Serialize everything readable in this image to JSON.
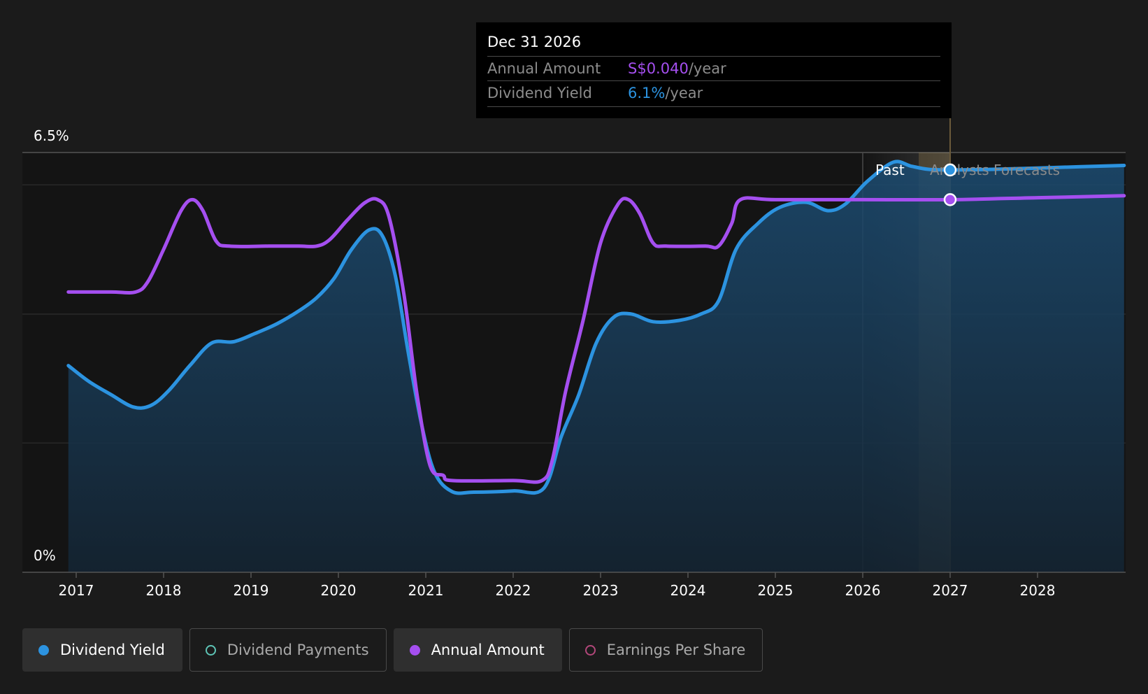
{
  "colors": {
    "background": "#1b1b1b",
    "yield": "#2c93e0",
    "annual": "#a54ff0",
    "payments": "#5ec4b6",
    "eps": "#b2477a",
    "forecast_band": "#c9a25a"
  },
  "tooltip": {
    "date": "Dec 31 2026",
    "rows": [
      {
        "label": "Annual Amount",
        "value": "S$0.040",
        "unit": "/year",
        "color": "#a54ff0"
      },
      {
        "label": "Dividend Yield",
        "value": "6.1%",
        "unit": "/year",
        "color": "#2c93e0"
      }
    ]
  },
  "chart_data": {
    "type": "line",
    "title": "",
    "xlabel": "",
    "ylabel": "",
    "x_ticks": [
      "2017",
      "2018",
      "2019",
      "2020",
      "2021",
      "2022",
      "2023",
      "2024",
      "2025",
      "2026",
      "2027",
      "2028"
    ],
    "x_range": [
      2016.4,
      2028.99
    ],
    "ylim": [
      0,
      6.5
    ],
    "y_tick_labels": [
      {
        "value": 6.5,
        "label": "6.5%"
      },
      {
        "value": 0,
        "label": "0%"
      }
    ],
    "grid": true,
    "region_labels": {
      "past": "Past",
      "forecast": "Analysts Forecasts"
    },
    "past_end": 2026.0,
    "highlight_x": 2027.0,
    "series": [
      {
        "name": "Dividend Yield",
        "color": "#2c93e0",
        "filled": true,
        "points": [
          [
            2016.91,
            3.2
          ],
          [
            2017.15,
            2.95
          ],
          [
            2017.4,
            2.75
          ],
          [
            2017.65,
            2.56
          ],
          [
            2017.85,
            2.58
          ],
          [
            2018.05,
            2.8
          ],
          [
            2018.3,
            3.2
          ],
          [
            2018.55,
            3.55
          ],
          [
            2018.8,
            3.57
          ],
          [
            2019.05,
            3.7
          ],
          [
            2019.3,
            3.85
          ],
          [
            2019.55,
            4.05
          ],
          [
            2019.75,
            4.25
          ],
          [
            2019.95,
            4.55
          ],
          [
            2020.15,
            5.0
          ],
          [
            2020.35,
            5.3
          ],
          [
            2020.5,
            5.22
          ],
          [
            2020.65,
            4.6
          ],
          [
            2020.8,
            3.4
          ],
          [
            2020.95,
            2.3
          ],
          [
            2021.1,
            1.55
          ],
          [
            2021.3,
            1.25
          ],
          [
            2021.55,
            1.24
          ],
          [
            2022.0,
            1.26
          ],
          [
            2022.35,
            1.3
          ],
          [
            2022.55,
            2.1
          ],
          [
            2022.75,
            2.75
          ],
          [
            2022.95,
            3.55
          ],
          [
            2023.15,
            3.95
          ],
          [
            2023.35,
            4.0
          ],
          [
            2023.6,
            3.88
          ],
          [
            2023.9,
            3.9
          ],
          [
            2024.15,
            4.0
          ],
          [
            2024.35,
            4.2
          ],
          [
            2024.55,
            5.0
          ],
          [
            2024.8,
            5.4
          ],
          [
            2025.05,
            5.65
          ],
          [
            2025.35,
            5.73
          ],
          [
            2025.6,
            5.6
          ],
          [
            2025.8,
            5.7
          ],
          [
            2026.05,
            6.05
          ],
          [
            2026.35,
            6.35
          ],
          [
            2026.55,
            6.29
          ],
          [
            2026.75,
            6.24
          ],
          [
            2027.0,
            6.23
          ],
          [
            2027.5,
            6.24
          ],
          [
            2028.0,
            6.26
          ],
          [
            2028.5,
            6.28
          ],
          [
            2028.99,
            6.3
          ]
        ]
      },
      {
        "name": "Annual Amount",
        "color": "#a54ff0",
        "filled": false,
        "points": [
          [
            2016.91,
            4.34
          ],
          [
            2017.4,
            4.34
          ],
          [
            2017.68,
            4.34
          ],
          [
            2017.82,
            4.5
          ],
          [
            2018.0,
            5.0
          ],
          [
            2018.2,
            5.6
          ],
          [
            2018.33,
            5.77
          ],
          [
            2018.45,
            5.6
          ],
          [
            2018.6,
            5.13
          ],
          [
            2018.75,
            5.05
          ],
          [
            2019.2,
            5.05
          ],
          [
            2019.55,
            5.05
          ],
          [
            2019.75,
            5.05
          ],
          [
            2019.9,
            5.15
          ],
          [
            2020.1,
            5.45
          ],
          [
            2020.3,
            5.72
          ],
          [
            2020.45,
            5.77
          ],
          [
            2020.58,
            5.5
          ],
          [
            2020.75,
            4.3
          ],
          [
            2020.9,
            2.75
          ],
          [
            2021.05,
            1.65
          ],
          [
            2021.2,
            1.5
          ],
          [
            2021.3,
            1.42
          ],
          [
            2022.0,
            1.42
          ],
          [
            2022.33,
            1.42
          ],
          [
            2022.45,
            1.75
          ],
          [
            2022.6,
            2.8
          ],
          [
            2022.8,
            3.9
          ],
          [
            2023.0,
            5.1
          ],
          [
            2023.2,
            5.7
          ],
          [
            2023.32,
            5.77
          ],
          [
            2023.45,
            5.55
          ],
          [
            2023.6,
            5.1
          ],
          [
            2023.75,
            5.05
          ],
          [
            2024.2,
            5.05
          ],
          [
            2024.35,
            5.05
          ],
          [
            2024.5,
            5.4
          ],
          [
            2024.6,
            5.77
          ],
          [
            2025.0,
            5.77
          ],
          [
            2026.0,
            5.77
          ],
          [
            2027.0,
            5.77
          ],
          [
            2028.0,
            5.8
          ],
          [
            2028.99,
            5.83
          ]
        ]
      }
    ]
  },
  "legend": [
    {
      "label": "Dividend Yield",
      "color": "#2c93e0",
      "style": "filled",
      "active": true
    },
    {
      "label": "Dividend Payments",
      "color": "#5ec4b6",
      "style": "hollow",
      "active": false
    },
    {
      "label": "Annual Amount",
      "color": "#a54ff0",
      "style": "filled",
      "active": true
    },
    {
      "label": "Earnings Per Share",
      "color": "#b2477a",
      "style": "hollow",
      "active": false
    }
  ]
}
